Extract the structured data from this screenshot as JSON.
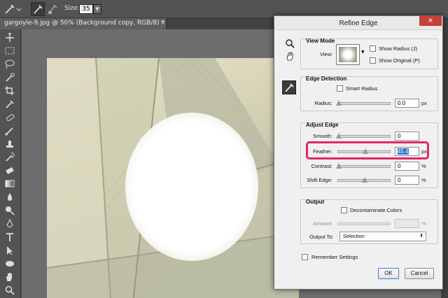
{
  "options_bar": {
    "size_label": "Size:",
    "size_value": "35"
  },
  "document_tab": {
    "title": "gargoyle-9.jpg @ 50% (Background copy, RGB/8) *",
    "close_glyph": "×"
  },
  "tools": [
    "move-tool-icon",
    "marquee-tool-icon",
    "lasso-tool-icon",
    "quick-selection-tool-icon",
    "crop-tool-icon",
    "eyedropper-tool-icon",
    "healing-brush-tool-icon",
    "brush-tool-icon",
    "clone-stamp-tool-icon",
    "history-brush-tool-icon",
    "eraser-tool-icon",
    "gradient-tool-icon",
    "blur-tool-icon",
    "dodge-tool-icon",
    "pen-tool-icon",
    "type-tool-icon",
    "path-selection-tool-icon",
    "shape-tool-icon",
    "hand-tool-icon",
    "zoom-tool-icon"
  ],
  "dialog": {
    "title": "Refine Edge",
    "close_glyph": "×",
    "view_mode": {
      "title": "View Mode",
      "view_label": "View:",
      "show_radius": "Show Radius (J)",
      "show_original": "Show Original (P)"
    },
    "edge_detection": {
      "title": "Edge Detection",
      "smart_radius": "Smart Radius",
      "radius_label": "Radius:",
      "radius_value": "0.0",
      "radius_unit": "px"
    },
    "adjust_edge": {
      "title": "Adjust Edge",
      "smooth_label": "Smooth:",
      "smooth_value": "0",
      "feather_label": "Feather:",
      "feather_value": "45.4",
      "feather_unit": "px",
      "contrast_label": "Contrast:",
      "contrast_value": "0",
      "contrast_unit": "%",
      "shift_edge_label": "Shift Edge:",
      "shift_edge_value": "0",
      "shift_edge_unit": "%"
    },
    "output": {
      "title": "Output",
      "decontaminate": "Decontaminate Colors",
      "amount_label": "Amount:",
      "amount_unit": "%",
      "output_to_label": "Output To:",
      "output_to_value": "Selection"
    },
    "remember_settings": "Remember Settings",
    "ok_label": "OK",
    "cancel_label": "Cancel"
  },
  "colors": {
    "highlight": "#e0276c",
    "ui_dark": "#535353"
  }
}
